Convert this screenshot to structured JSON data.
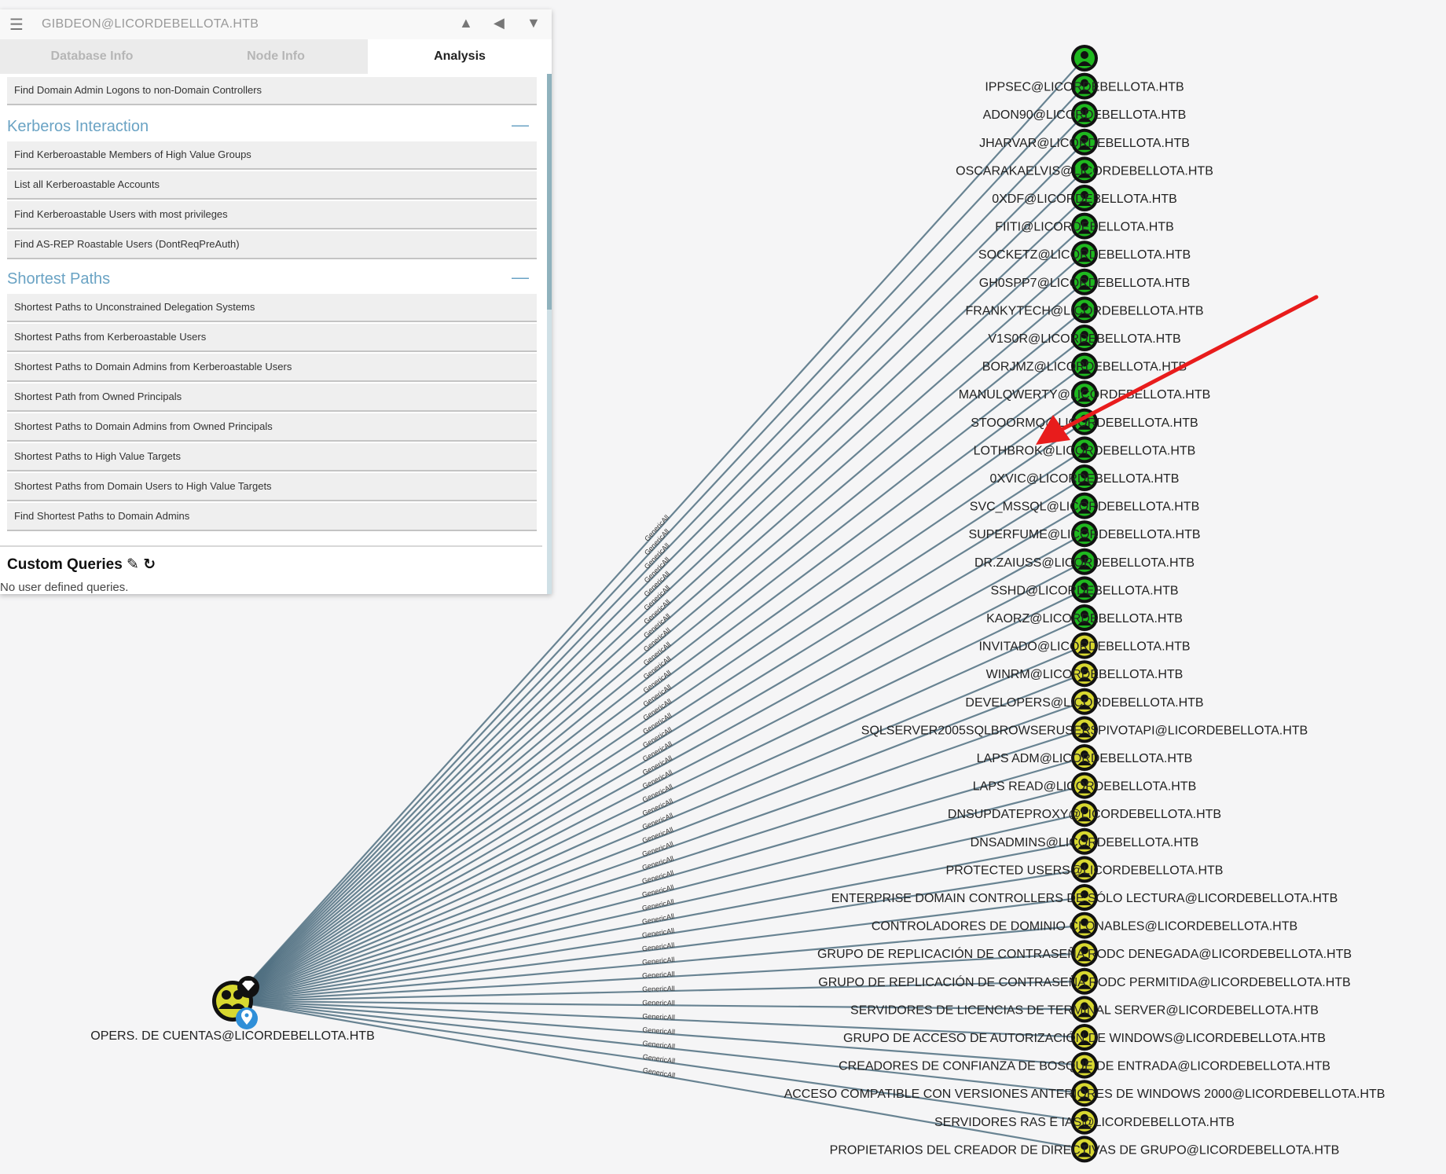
{
  "app": {
    "current_user": "GIBDEON@LICORDEBELLOTA.HTB",
    "icons": [
      "menu-icon",
      "pathfinding-icon",
      "back-icon",
      "filter-icon"
    ]
  },
  "tabs": [
    {
      "label": "Database Info",
      "active": false
    },
    {
      "label": "Node Info",
      "active": false
    },
    {
      "label": "Analysis",
      "active": true
    }
  ],
  "analysis": {
    "top_item": "Find Domain Admin Logons to non-Domain Controllers",
    "kerberos": {
      "title": "Kerberos Interaction",
      "toggle": "—",
      "items": [
        "Find Kerberoastable Members of High Value Groups",
        "List all Kerberoastable Accounts",
        "Find Kerberoastable Users with most privileges",
        "Find AS-REP Roastable Users (DontReqPreAuth)"
      ]
    },
    "shortest": {
      "title": "Shortest Paths",
      "toggle": "—",
      "items": [
        "Shortest Paths to Unconstrained Delegation Systems",
        "Shortest Paths from Kerberoastable Users",
        "Shortest Paths to Domain Admins from Kerberoastable Users",
        "Shortest Path from Owned Principals",
        "Shortest Paths to Domain Admins from Owned Principals",
        "Shortest Paths to High Value Targets",
        "Shortest Paths from Domain Users to High Value Targets",
        "Find Shortest Paths to Domain Admins"
      ]
    },
    "custom": {
      "title": "Custom Queries",
      "empty": "No user defined queries."
    }
  },
  "graph": {
    "source_label": "OPERS. DE CUENTAS@LICORDEBELLOTA.HTB",
    "edge_label": "GenericAll",
    "edge_color": "#4f6e80",
    "user_color": "#1fb81f",
    "group_color": "#d8d830",
    "annotation_arrow_color": "#e81c1c",
    "targets": [
      {
        "label": "",
        "kind": "user"
      },
      {
        "label": "IPPSEC@LICORDEBELLOTA.HTB",
        "kind": "user"
      },
      {
        "label": "ADON90@LICORDEBELLOTA.HTB",
        "kind": "user"
      },
      {
        "label": "JHARVAR@LICORDEBELLOTA.HTB",
        "kind": "user"
      },
      {
        "label": "OSCARAKAELVIS@LICORDEBELLOTA.HTB",
        "kind": "user"
      },
      {
        "label": "0XDF@LICORDEBELLOTA.HTB",
        "kind": "user"
      },
      {
        "label": "FIITI@LICORDEBELLOTA.HTB",
        "kind": "user"
      },
      {
        "label": "SOCKETZ@LICORDEBELLOTA.HTB",
        "kind": "user"
      },
      {
        "label": "GH0SPP7@LICORDEBELLOTA.HTB",
        "kind": "user"
      },
      {
        "label": "FRANKYTECH@LICORDEBELLOTA.HTB",
        "kind": "user"
      },
      {
        "label": "V1S0R@LICORDEBELLOTA.HTB",
        "kind": "user"
      },
      {
        "label": "BORJMZ@LICORDEBELLOTA.HTB",
        "kind": "user"
      },
      {
        "label": "MANULQWERTY@LICORDEBELLOTA.HTB",
        "kind": "user"
      },
      {
        "label": "STOOORMQ@LICORDEBELLOTA.HTB",
        "kind": "user"
      },
      {
        "label": "LOTHBROK@LICORDEBELLOTA.HTB",
        "kind": "user"
      },
      {
        "label": "0XVIC@LICORDEBELLOTA.HTB",
        "kind": "user"
      },
      {
        "label": "SVC_MSSQL@LICORDEBELLOTA.HTB",
        "kind": "user"
      },
      {
        "label": "SUPERFUME@LICORDEBELLOTA.HTB",
        "kind": "user"
      },
      {
        "label": "DR.ZAIUSS@LICORDEBELLOTA.HTB",
        "kind": "user"
      },
      {
        "label": "SSHD@LICORDEBELLOTA.HTB",
        "kind": "user"
      },
      {
        "label": "KAORZ@LICORDEBELLOTA.HTB",
        "kind": "user"
      },
      {
        "label": "INVITADO@LICORDEBELLOTA.HTB",
        "kind": "group"
      },
      {
        "label": "WINRM@LICORDEBELLOTA.HTB",
        "kind": "group"
      },
      {
        "label": "DEVELOPERS@LICORDEBELLOTA.HTB",
        "kind": "group"
      },
      {
        "label": "SQLSERVER2005SQLBROWSERUSER$PIVOTAPI@LICORDEBELLOTA.HTB",
        "kind": "group"
      },
      {
        "label": "LAPS ADM@LICORDEBELLOTA.HTB",
        "kind": "group"
      },
      {
        "label": "LAPS READ@LICORDEBELLOTA.HTB",
        "kind": "group"
      },
      {
        "label": "DNSUPDATEPROXY@LICORDEBELLOTA.HTB",
        "kind": "group"
      },
      {
        "label": "DNSADMINS@LICORDEBELLOTA.HTB",
        "kind": "group"
      },
      {
        "label": "PROTECTED USERS@LICORDEBELLOTA.HTB",
        "kind": "group"
      },
      {
        "label": "ENTERPRISE DOMAIN CONTROLLERS DE SÓLO LECTURA@LICORDEBELLOTA.HTB",
        "kind": "group"
      },
      {
        "label": "CONTROLADORES DE DOMINIO CLONABLES@LICORDEBELLOTA.HTB",
        "kind": "group"
      },
      {
        "label": "GRUPO DE REPLICACIÓN DE CONTRASEÑA RODC DENEGADA@LICORDEBELLOTA.HTB",
        "kind": "group"
      },
      {
        "label": "GRUPO DE REPLICACIÓN DE CONTRASEÑA RODC PERMITIDA@LICORDEBELLOTA.HTB",
        "kind": "group"
      },
      {
        "label": "SERVIDORES DE LICENCIAS DE TERMINAL SERVER@LICORDEBELLOTA.HTB",
        "kind": "group"
      },
      {
        "label": "GRUPO DE ACCESO DE AUTORIZACIÓN DE WINDOWS@LICORDEBELLOTA.HTB",
        "kind": "group"
      },
      {
        "label": "CREADORES DE CONFIANZA DE BOSQUE DE ENTRADA@LICORDEBELLOTA.HTB",
        "kind": "group"
      },
      {
        "label": "ACCESO COMPATIBLE CON VERSIONES ANTERIORES DE WINDOWS 2000@LICORDEBELLOTA.HTB",
        "kind": "group"
      },
      {
        "label": "SERVIDORES RAS E IAS@LICORDEBELLOTA.HTB",
        "kind": "group"
      },
      {
        "label": "PROPIETARIOS DEL CREADOR DE DIRECTIVAS DE GRUPO@LICORDEBELLOTA.HTB",
        "kind": "group"
      }
    ]
  }
}
